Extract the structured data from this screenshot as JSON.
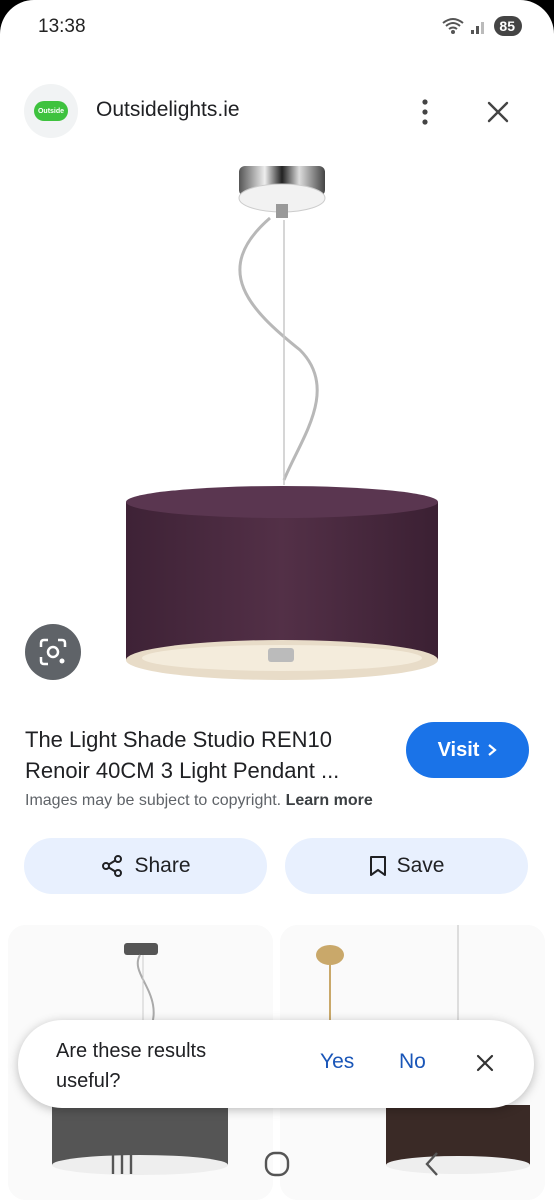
{
  "status_bar": {
    "time": "13:38",
    "battery": "85"
  },
  "header": {
    "site_name": "Outsidelights.ie",
    "logo_text": "Outside"
  },
  "product": {
    "title": "The Light Shade Studio REN10 Renoir 40CM 3 Light Pendant ...",
    "visit_label": "Visit",
    "copyright_text": "Images may be subject to copyright.",
    "learn_more_label": "Learn more"
  },
  "actions": {
    "share_label": "Share",
    "save_label": "Save"
  },
  "feedback": {
    "question": "Are these results useful?",
    "yes_label": "Yes",
    "no_label": "No"
  },
  "colors": {
    "accent": "#1a73e8",
    "shade": "#4a2a42",
    "chip_bg": "#e8f0fe"
  }
}
